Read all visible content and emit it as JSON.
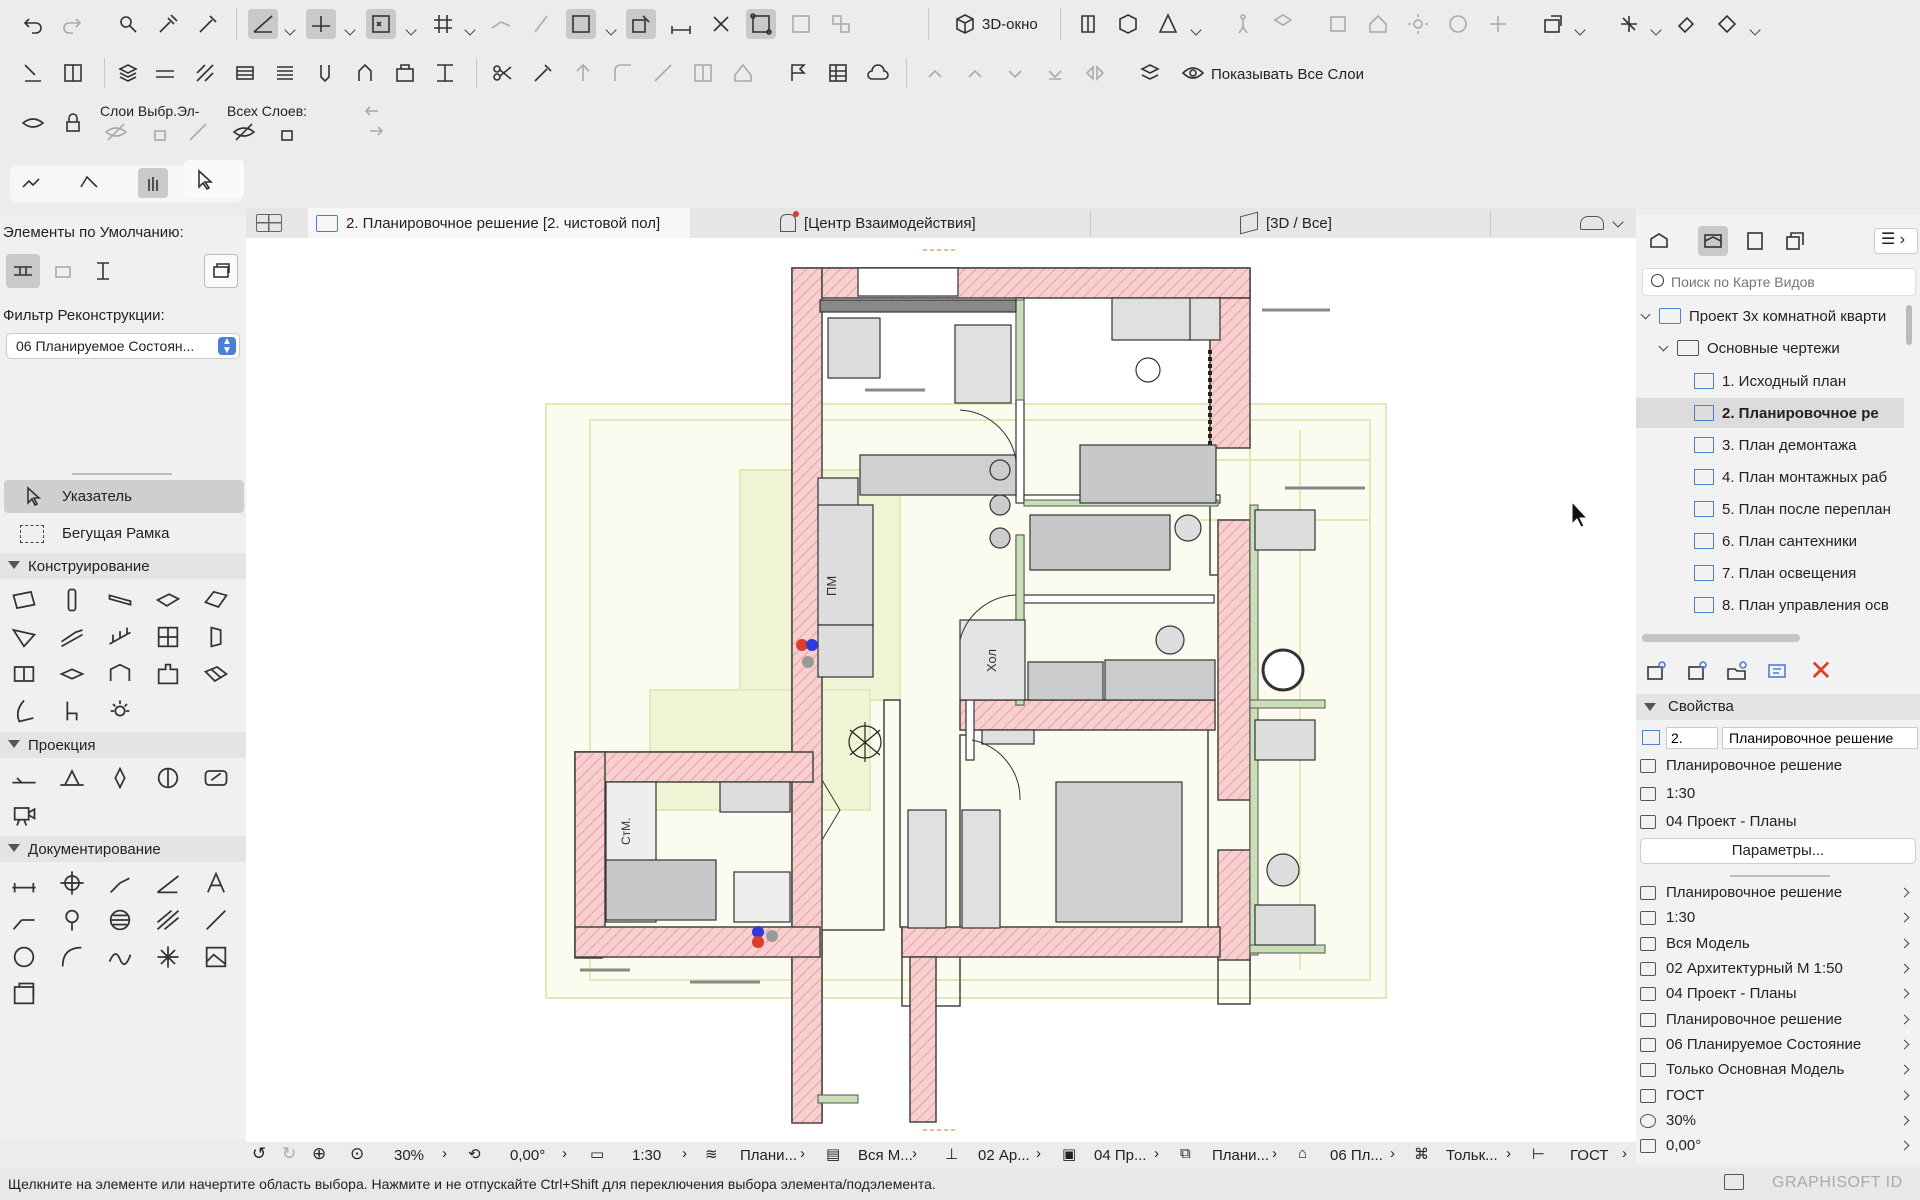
{
  "toolbar": {
    "view3d_label": "3D-окно",
    "show_layers_label": "Показывать Все Слои",
    "layers_sel_label": "Слои Выбр.Эл-",
    "all_layers_label": "Всех Слоев:"
  },
  "left_panel": {
    "defaults_label": "Элементы по Умолчанию:",
    "reno_filter_label": "Фильтр Реконструкции:",
    "reno_filter_value": "06 Планируемое Состоян...",
    "pointer_label": "Указатель",
    "marquee_label": "Бегущая Рамка",
    "sections": [
      "Конструирование",
      "Проекция",
      "Документирование"
    ]
  },
  "tabs": [
    {
      "label": "2. Планировочное решение [2. чистовой пол]"
    },
    {
      "label": "[Центр Взаимодействия]"
    },
    {
      "label": "[3D / Все]"
    }
  ],
  "plan_labels": {
    "pm": "ПМ",
    "hol": "Хол",
    "stm": "СтМ."
  },
  "navigator": {
    "search_placeholder": "Поиск по Карте Видов",
    "items": [
      {
        "label": "Проект 3х комнатной кварти",
        "level": 0
      },
      {
        "label": "Основные чертежи",
        "level": 1
      },
      {
        "label": "1. Исходный план",
        "level": 2
      },
      {
        "label": "2. Планировочное ре",
        "level": 2
      },
      {
        "label": "3. План демонтажа",
        "level": 2
      },
      {
        "label": "4. План монтажных раб",
        "level": 2
      },
      {
        "label": "5. План после переплан",
        "level": 2
      },
      {
        "label": "6. План сантехники",
        "level": 2
      },
      {
        "label": "7. План освещения",
        "level": 2
      },
      {
        "label": "8. План управления осв",
        "level": 2
      }
    ],
    "selected_index": 3
  },
  "properties": {
    "header": "Свойства",
    "id_value": "2.",
    "name_value": "Планировочное решение",
    "layer_combo": "Планировочное решение",
    "scale": "1:30",
    "view_set": "04 Проект - Планы",
    "params_button": "Параметры...",
    "settings_rows": [
      "Планировочное решение",
      "1:30",
      "Вся Модель",
      "02 Архитектурный М 1:50",
      "04 Проект - Планы",
      "Планировочное решение",
      "06 Планируемое Состояние",
      "Только Основная Модель",
      "ГОСТ",
      "30%",
      "0,00°"
    ]
  },
  "statusbar": {
    "zoom": "30%",
    "angle": "0,00°",
    "scale": "1:30",
    "layer": "Плани...",
    "model": "Вся М...",
    "pen": "02 Ар...",
    "viewset": "04 Пр...",
    "override": "Плани...",
    "reno": "06 Пл...",
    "structure": "Тольк...",
    "dim": "ГОСТ"
  },
  "hint": "Щелкните на элементе или начертите область выбора. Нажмите и не отпускайте Ctrl+Shift для переключения выбора элемента/подэлемента.",
  "brand": "GRAPHISOFT ID",
  "colors": {
    "wall_fill": "#f4c3c3",
    "wall_hatch": "#e08a8a",
    "green_wall": "#c8dfb8",
    "bg_plan": "#f3f4e2",
    "accent_red": "#e03c2c"
  }
}
